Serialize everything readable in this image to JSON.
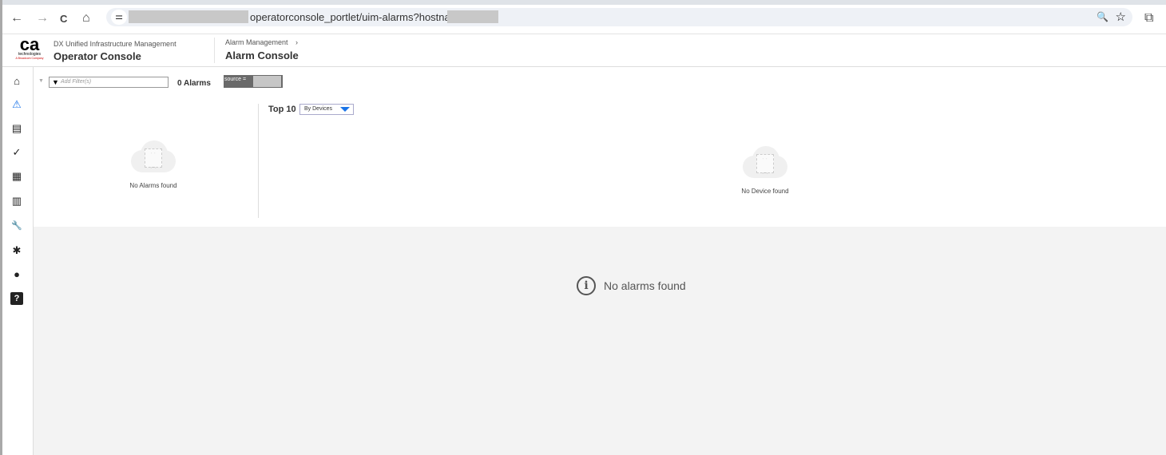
{
  "browser": {
    "url_visible": "operatorconsole_portlet/uim-alarms?hostname=",
    "icons": [
      "back-icon",
      "forward-icon",
      "reload-icon",
      "home-icon",
      "site-settings-icon",
      "zoom-icon",
      "star-icon",
      "extensions-icon"
    ],
    "glyphs": {
      "back": "←",
      "forward": "→",
      "reload": "C",
      "home": "⌂",
      "tune": "⚌",
      "zoom": "🔍",
      "star": "☆",
      "ext": "⧉"
    }
  },
  "header": {
    "logo_text": "ca",
    "logo_sub": "technologies",
    "logo_tag": "A Broadcom Company",
    "product": "DX Unified Infrastructure Management",
    "app_title": "Operator Console",
    "breadcrumb_parent": "Alarm Management",
    "breadcrumb_sep": "›",
    "page_title": "Alarm Console"
  },
  "sidebar": {
    "items": [
      {
        "name": "home",
        "glyph": "⌂"
      },
      {
        "name": "alarms",
        "glyph": "⚠"
      },
      {
        "name": "devices",
        "glyph": "▤"
      },
      {
        "name": "reports",
        "glyph": "✓"
      },
      {
        "name": "dashboards",
        "glyph": "▦"
      },
      {
        "name": "metrics",
        "glyph": "▥"
      },
      {
        "name": "tools",
        "glyph": "🔧"
      },
      {
        "name": "settings",
        "glyph": "✱"
      },
      {
        "name": "chat",
        "glyph": "●"
      },
      {
        "name": "help",
        "glyph": "?"
      }
    ],
    "active_color": "#1a73e8"
  },
  "toolbar": {
    "filter_placeholder": "Add Filter(s)",
    "filter_icon": "▼",
    "alarm_count": "0 Alarms",
    "source_chip": "source ="
  },
  "left_panel": {
    "empty_text": "No Alarms found"
  },
  "top_panel": {
    "label": "Top 10",
    "dropdown_value": "By Devices",
    "empty_text": "No Device found"
  },
  "table": {
    "empty_text": "No alarms found",
    "info_glyph": "i"
  }
}
